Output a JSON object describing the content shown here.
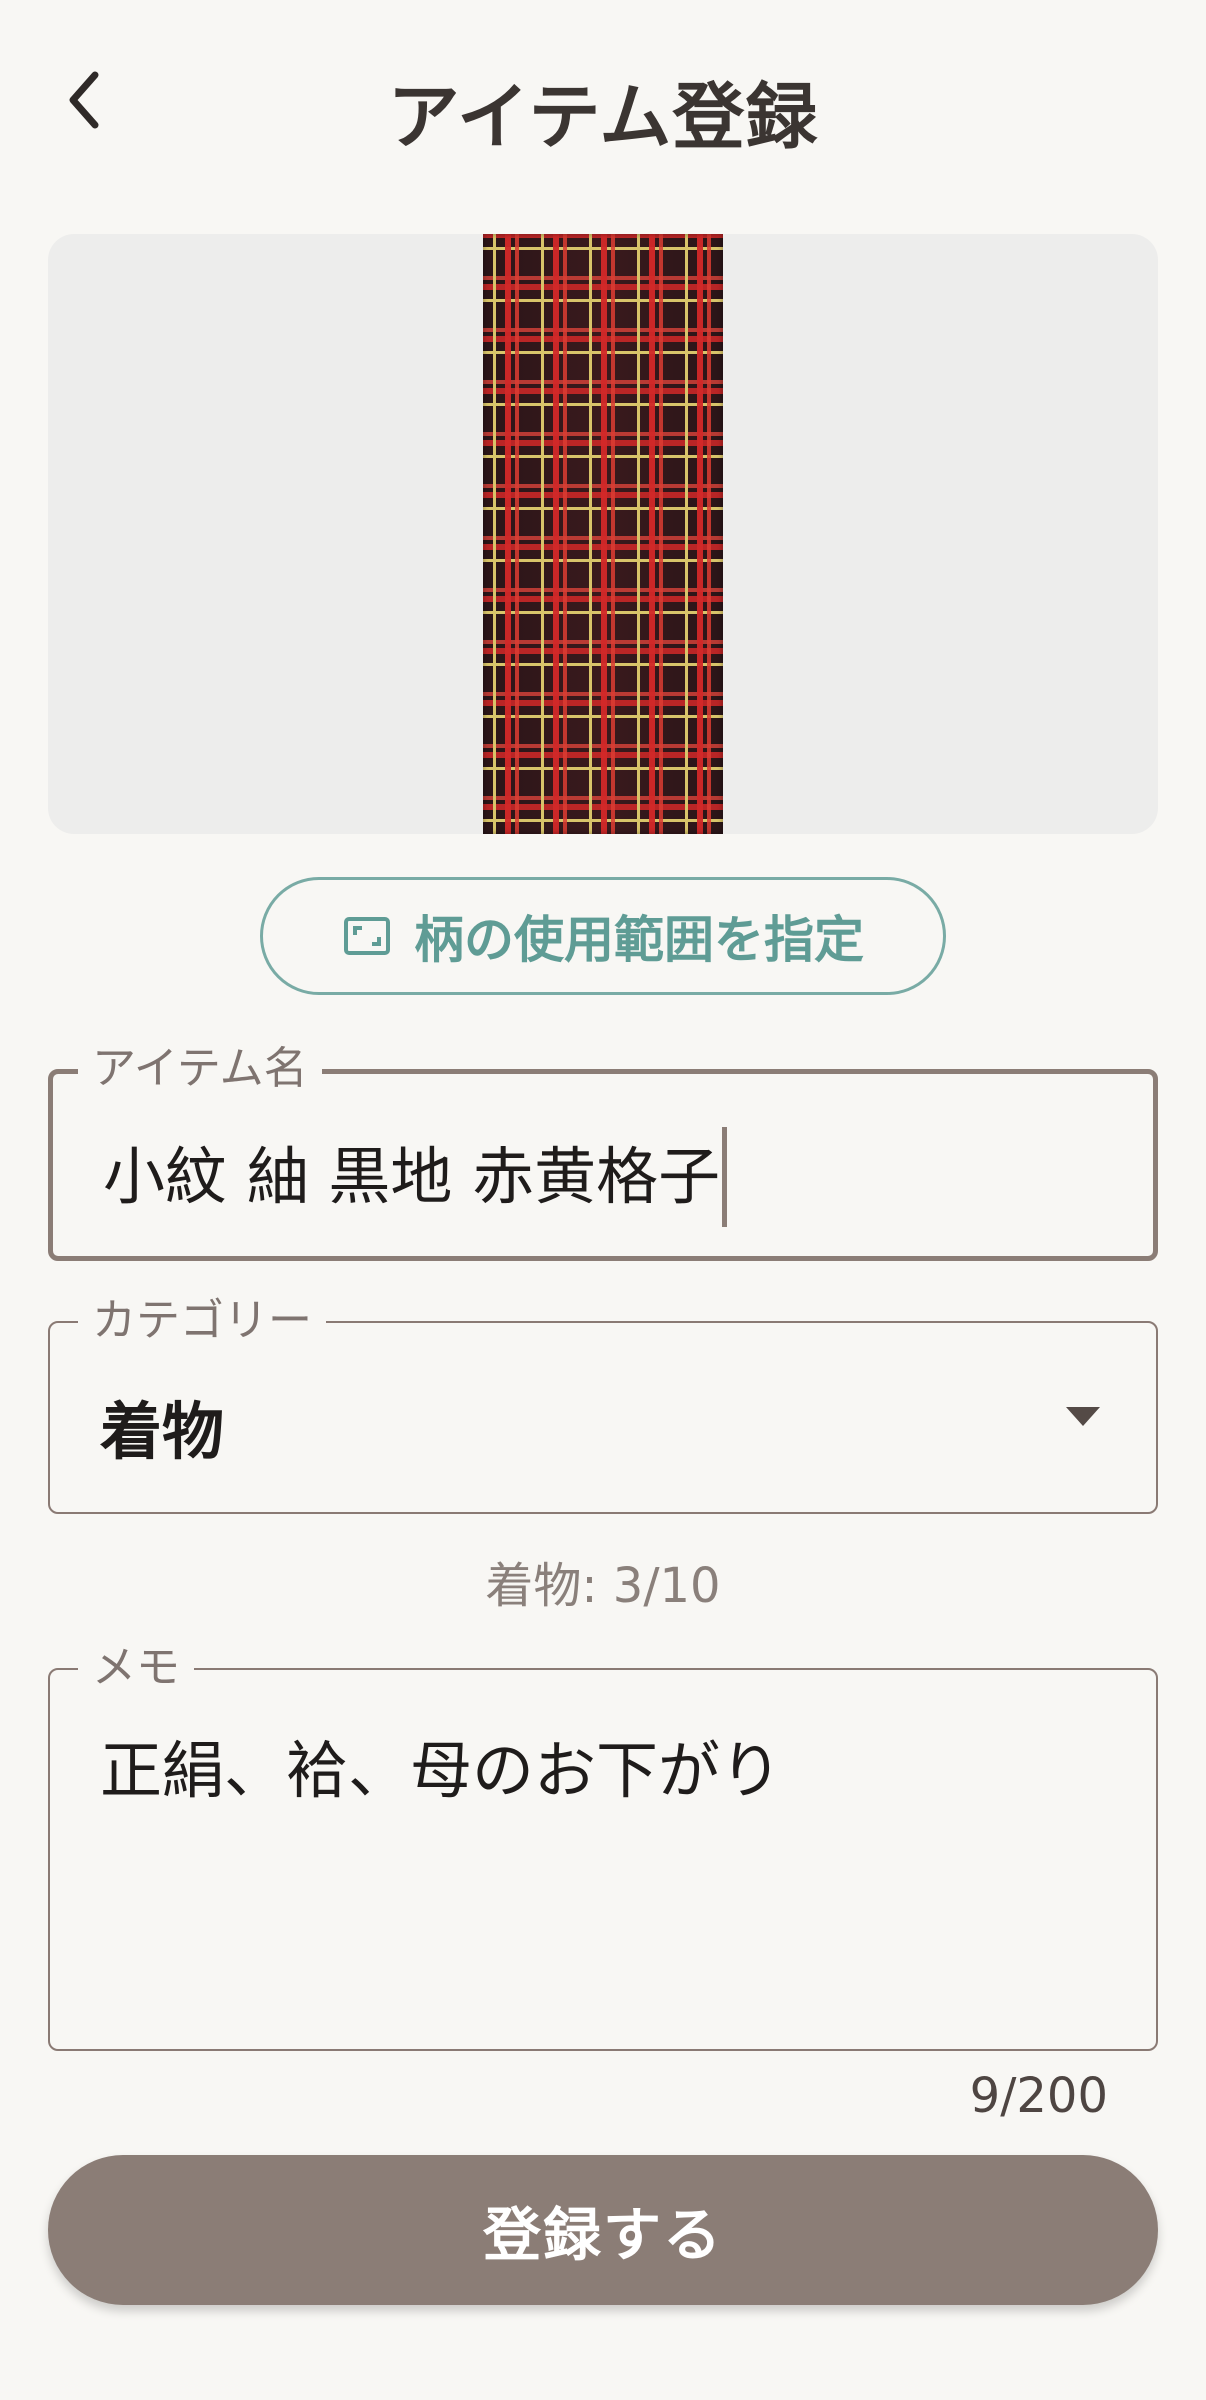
{
  "header": {
    "title": "アイテム登録",
    "back_icon": "chevron-left-icon"
  },
  "image_preview": {
    "pattern": "red-black tartan plaid with yellow lines"
  },
  "pattern_button": {
    "label": "柄の使用範囲を指定",
    "icon": "crop-frame-icon",
    "accent_color": "#5f9c95"
  },
  "item_name": {
    "label": "アイテム名",
    "value": "小紋 紬 黒地 赤黄格子"
  },
  "category": {
    "label": "カテゴリー",
    "value": "着物",
    "count_text": "着物: 3/10"
  },
  "memo": {
    "label": "メモ",
    "value": "正絹、袷、母のお下がり",
    "counter": "9/200"
  },
  "submit": {
    "label": "登録する",
    "color": "#8b7d76"
  }
}
